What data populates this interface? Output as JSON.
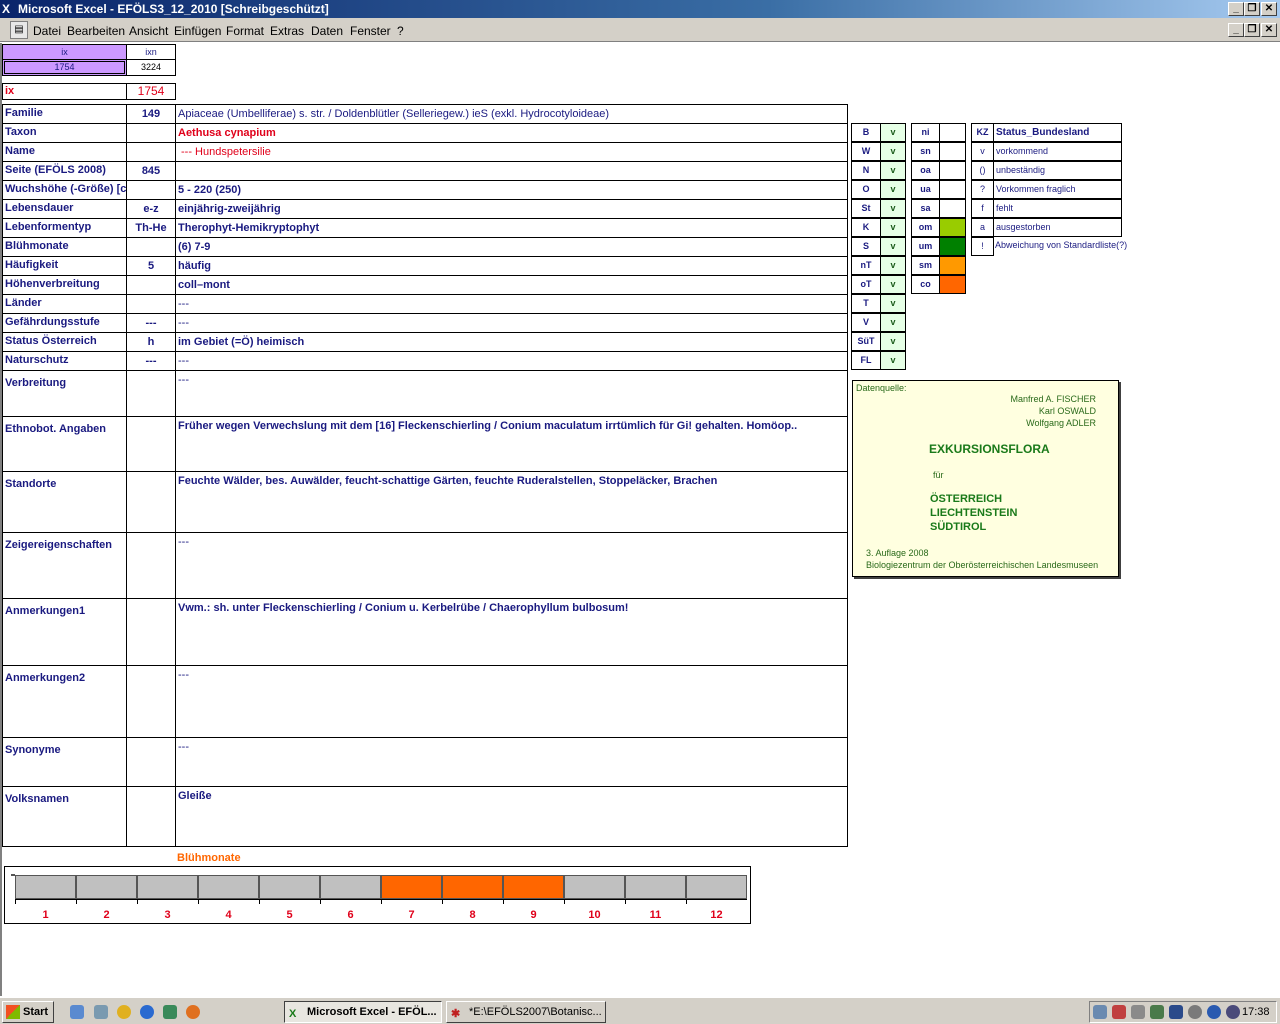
{
  "window": {
    "title": "Microsoft Excel - EFÖLS3_12_2010  [Schreibgeschützt]",
    "icon": "excel-icon"
  },
  "menu": [
    "Datei",
    "Bearbeiten",
    "Ansicht",
    "Einfügen",
    "Format",
    "Extras",
    "Daten",
    "Fenster",
    "?"
  ],
  "index": {
    "ix_header": "ix",
    "ixn_header": "ixn",
    "ix_value": "1754",
    "ixn_value": "3224",
    "ix_label": "ix",
    "ix_big": "1754"
  },
  "rows": [
    {
      "label": "Familie",
      "code": "149",
      "value": "Apiaceae (Umbelliferae) s. str.  /  Doldenblütler (Selleriegew.) ieS (exkl. Hydrocotyloideae)"
    },
    {
      "label": "Taxon",
      "code": "",
      "value": "Aethusa cynapium"
    },
    {
      "label": "Name",
      "code": "",
      "value": "--- Hundspetersilie"
    },
    {
      "label": "Seite (EFÖLS 2008)",
      "code": "845",
      "value": ""
    },
    {
      "label": "Wuchshöhe (-Größe) [cm]",
      "code": "",
      "value": "5 - 220 (250)"
    },
    {
      "label": "Lebensdauer",
      "code": "e-z",
      "value": "einjährig-zweijährig"
    },
    {
      "label": "Lebenformentyp",
      "code": "Th-He",
      "value": "Therophyt-Hemikryptophyt"
    },
    {
      "label": "Blühmonate",
      "code": "",
      "value": "(6) 7-9"
    },
    {
      "label": "Häufigkeit",
      "code": "5",
      "value": "häufig"
    },
    {
      "label": "Höhenverbreitung",
      "code": "",
      "value": "coll–mont"
    },
    {
      "label": "Länder",
      "code": "",
      "value": "---"
    },
    {
      "label": "Gefährdungsstufe",
      "code": "---",
      "value": "---"
    },
    {
      "label": "Status Österreich",
      "code": "h",
      "value": "im Gebiet (=Ö) heimisch"
    },
    {
      "label": "Naturschutz",
      "code": "---",
      "value": "---"
    }
  ],
  "tall_rows": [
    {
      "label": "Verbreitung",
      "value": "---"
    },
    {
      "label": "Ethnobot. Angaben",
      "value": "Früher wegen Verwechslung mit dem [16] Fleckenschierling / Conium maculatum irrtümlich für Gi! gehalten. Homöop.."
    },
    {
      "label": "Standorte",
      "value": "Feuchte Wälder, bes. Auwälder, feucht-schattige Gärten, feuchte Ruderalstellen, Stoppeläcker, Brachen"
    },
    {
      "label": "Zeigereigenschaften",
      "value": "---"
    },
    {
      "label": "Anmerkungen1",
      "value": "Vwm.: sh. unter Fleckenschierling / Conium u. Kerbelrübe / Chaerophyllum bulbosum!"
    },
    {
      "label": "Anmerkungen2",
      "value": "---"
    },
    {
      "label": "Synonyme",
      "value": "---"
    },
    {
      "label": "Volksnamen",
      "value": "Gleiße"
    }
  ],
  "states": [
    {
      "code": "B",
      "status": "v"
    },
    {
      "code": "W",
      "status": "v"
    },
    {
      "code": "N",
      "status": "v"
    },
    {
      "code": "O",
      "status": "v"
    },
    {
      "code": "St",
      "status": "v"
    },
    {
      "code": "K",
      "status": "v"
    },
    {
      "code": "S",
      "status": "v"
    },
    {
      "code": "nT",
      "status": "v"
    },
    {
      "code": "oT",
      "status": "v"
    },
    {
      "code": "T",
      "status": "v"
    },
    {
      "code": "V",
      "status": "v"
    },
    {
      "code": "SüT",
      "status": "v"
    },
    {
      "code": "FL",
      "status": "v"
    }
  ],
  "regions": [
    {
      "code": "ni",
      "color": "#ffffff"
    },
    {
      "code": "sn",
      "color": "#ffffff"
    },
    {
      "code": "oa",
      "color": "#ffffff"
    },
    {
      "code": "ua",
      "color": "#ffffff"
    },
    {
      "code": "sa",
      "color": "#ffffff"
    },
    {
      "code": "om",
      "color": "#99cc00"
    },
    {
      "code": "um",
      "color": "#008000"
    },
    {
      "code": "sm",
      "color": "#ff9900"
    },
    {
      "code": "co",
      "color": "#ff6600"
    }
  ],
  "status_legend": {
    "kz_header": "KZ",
    "title": "Status_Bundesland",
    "items": [
      {
        "kz": "v",
        "text": "vorkommend"
      },
      {
        "kz": "()",
        "text": "unbeständig"
      },
      {
        "kz": "?",
        "text": "Vorkommen fraglich"
      },
      {
        "kz": "f",
        "text": "fehlt"
      },
      {
        "kz": "a",
        "text": "ausgestorben"
      },
      {
        "kz": "!",
        "text": "Abweichung von Standardliste(?)"
      }
    ]
  },
  "source": {
    "label": "Datenquelle:",
    "authors": [
      "Manfred A. FISCHER",
      "Karl OSWALD",
      "Wolfgang ADLER"
    ],
    "title": "EXKURSIONSFLORA",
    "fuer": "für",
    "countries": [
      "ÖSTERREICH",
      "LIECHTENSTEIN",
      "SÜDTIROL"
    ],
    "edition": "3. Auflage 2008",
    "publisher": "Biologiezentrum der Oberösterreichischen Landesmuseen"
  },
  "bloom_chart": {
    "title": "Blühmonate",
    "months": [
      "1",
      "2",
      "3",
      "4",
      "5",
      "6",
      "7",
      "8",
      "9",
      "10",
      "11",
      "12"
    ],
    "active": [
      false,
      false,
      false,
      false,
      false,
      false,
      true,
      true,
      true,
      false,
      false,
      false
    ],
    "active_color": "#ff6600",
    "inactive_color": "#c0c0c0"
  },
  "taskbar": {
    "start": "Start",
    "tasks": [
      "Microsoft Excel - EFÖL...",
      "*E:\\EFÖLS2007\\Botanisc..."
    ],
    "clock": "17:38"
  }
}
